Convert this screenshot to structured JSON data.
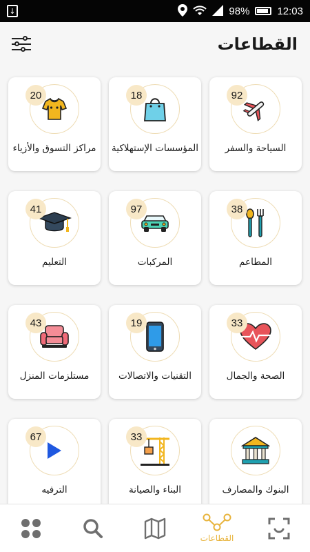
{
  "status_bar": {
    "battery": "98%",
    "time": "12:03"
  },
  "header": {
    "title": "القطاعات"
  },
  "sectors": [
    {
      "id": "travel",
      "label": "السياحة والسفر",
      "count": "92",
      "icon": "airplane-icon"
    },
    {
      "id": "consumer",
      "label": "المؤسسات الإستهلاكية",
      "count": "18",
      "icon": "shopping-bag-icon"
    },
    {
      "id": "fashion",
      "label": "مراكز التسوق والأزياء",
      "count": "20",
      "icon": "shirt-icon"
    },
    {
      "id": "restaurants",
      "label": "المطاعم",
      "count": "38",
      "icon": "fork-spoon-icon"
    },
    {
      "id": "vehicles",
      "label": "المركبات",
      "count": "97",
      "icon": "car-icon"
    },
    {
      "id": "education",
      "label": "التعليم",
      "count": "41",
      "icon": "graduation-cap-icon"
    },
    {
      "id": "health",
      "label": "الصحة والجمال",
      "count": "33",
      "icon": "heart-pulse-icon"
    },
    {
      "id": "tech",
      "label": "التقنيات والاتصالات",
      "count": "19",
      "icon": "smartphone-icon"
    },
    {
      "id": "home",
      "label": "مستلزمات المنزل",
      "count": "43",
      "icon": "armchair-icon"
    },
    {
      "id": "banks",
      "label": "البنوك والمصارف",
      "count": "",
      "icon": "bank-icon"
    },
    {
      "id": "construction",
      "label": "البناء والصيانة",
      "count": "33",
      "icon": "crane-icon"
    },
    {
      "id": "entertainment",
      "label": "الترفيه",
      "count": "67",
      "icon": "play-icon"
    }
  ],
  "bottom_nav": {
    "active_label": "القطاعات"
  },
  "colors": {
    "accent": "#e8b33b",
    "badge": "#f8e8c7",
    "ring": "#eedcb4"
  }
}
